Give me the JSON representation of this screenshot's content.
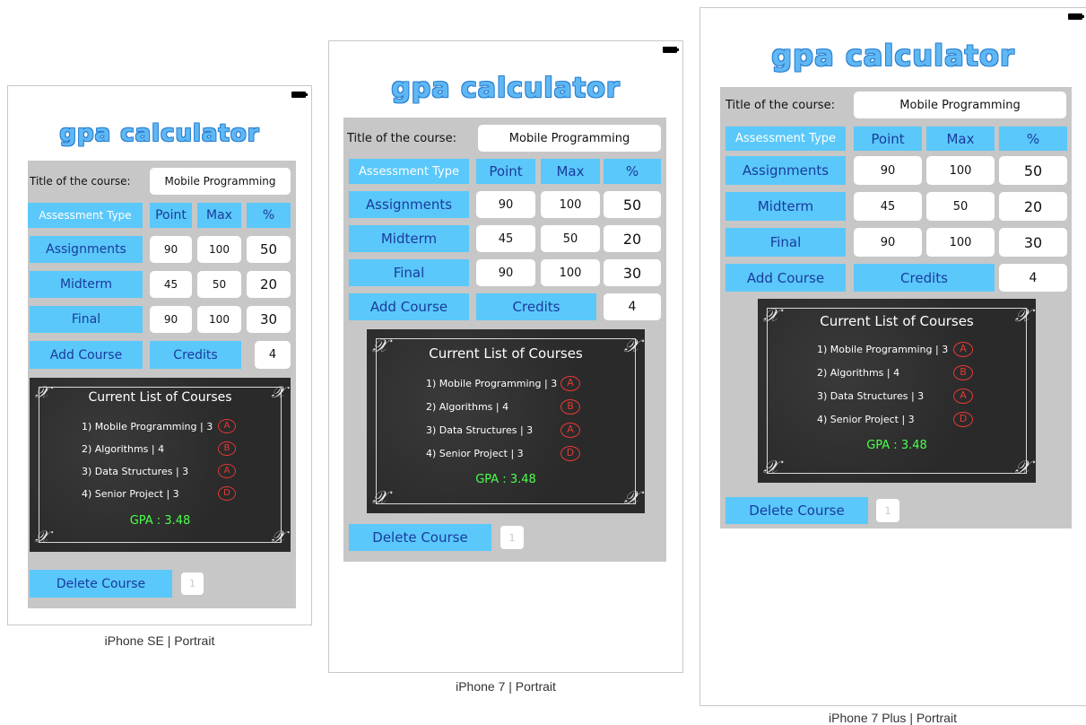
{
  "app": {
    "title": "gpa calculator",
    "course_label": "Title of the course:",
    "course_value": "Mobile Programming",
    "headers": [
      "Assessment Type",
      "Point",
      "Max",
      "%"
    ],
    "rows": [
      {
        "type": "Assignments",
        "point": "90",
        "max": "100",
        "pct": "50"
      },
      {
        "type": "Midterm",
        "point": "45",
        "max": "50",
        "pct": "20"
      },
      {
        "type": "Final",
        "point": "90",
        "max": "100",
        "pct": "30"
      }
    ],
    "add_course_label": "Add Course",
    "credits_label": "Credits",
    "credits_value": "4",
    "board_title": "Current List of Courses",
    "courses": [
      {
        "text": "1) Mobile Programming | 3",
        "grade": "A"
      },
      {
        "text": "2) Algorithms | 4",
        "grade": "B"
      },
      {
        "text": "3) Data Structures | 3",
        "grade": "A"
      },
      {
        "text": "4) Senior Project | 3",
        "grade": "D"
      }
    ],
    "gpa_text": "GPA :  3.48",
    "delete_label": "Delete Course",
    "delete_value": "1"
  },
  "captions": {
    "se": "iPhone SE | Portrait",
    "i7": "iPhone 7 | Portrait",
    "i7plus": "iPhone 7 Plus | Portrait"
  },
  "colors": {
    "accent_blue": "#5ac8fa",
    "label_blue": "#1a3b9e",
    "panel_gray": "#c7c7c7",
    "grade_red": "#e53935",
    "gpa_green": "#4cff4c"
  }
}
